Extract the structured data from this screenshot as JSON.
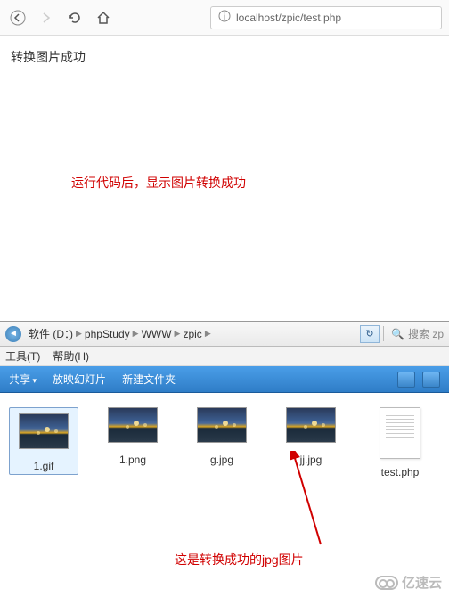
{
  "browser": {
    "url": "localhost/zpic/test.php",
    "page_message": "转换图片成功"
  },
  "annotations": {
    "top": "运行代码后，显示图片转换成功",
    "bottom": "这是转换成功的jpg图片"
  },
  "explorer": {
    "breadcrumb": [
      "软件 (D：)",
      "phpStudy",
      "WWW",
      "zpic"
    ],
    "search_placeholder": "搜索 zp",
    "menu": {
      "tools": "工具(T)",
      "help": "帮助(H)"
    },
    "toolbar": {
      "share": "共享",
      "slideshow": "放映幻灯片",
      "newfolder": "新建文件夹"
    },
    "files": [
      {
        "name": "1.gif",
        "type": "img",
        "selected": true
      },
      {
        "name": "1.png",
        "type": "img",
        "selected": false
      },
      {
        "name": "g.jpg",
        "type": "img",
        "selected": false
      },
      {
        "name": "jj.jpg",
        "type": "img",
        "selected": false
      },
      {
        "name": "test.php",
        "type": "php",
        "selected": false
      }
    ]
  },
  "watermark": "亿速云"
}
